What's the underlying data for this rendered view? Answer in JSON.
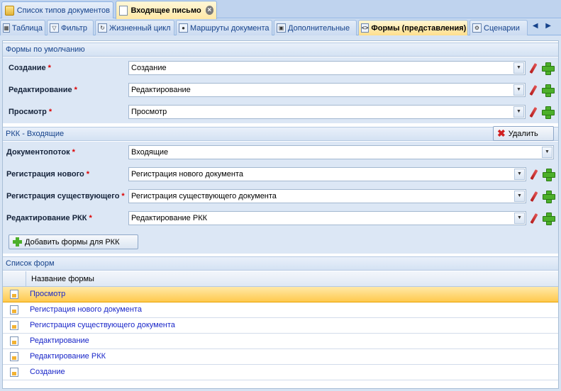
{
  "doc_tabs": [
    {
      "label": "Список типов документов",
      "icon": "folder-icon",
      "active": false
    },
    {
      "label": "Входящее письмо",
      "icon": "document-icon",
      "active": true
    }
  ],
  "prop_tabs": [
    {
      "label": "Таблица",
      "icon": "table-icon"
    },
    {
      "label": "Фильтр",
      "icon": "filter-icon"
    },
    {
      "label": "Жизненный цикл",
      "icon": "lifecycle-icon"
    },
    {
      "label": "Маршруты документа",
      "icon": "routes-icon"
    },
    {
      "label": "Дополнительные",
      "icon": "extra-icon"
    },
    {
      "label": "Формы (представления)",
      "icon": "forms-icon",
      "active": true
    },
    {
      "label": "Сценарии",
      "icon": "scenarios-icon"
    }
  ],
  "nav_arrows": "◀ ▶",
  "default_forms": {
    "header": "Формы по умолчанию",
    "rows": [
      {
        "label": "Создание",
        "value": "Создание"
      },
      {
        "label": "Редактирование",
        "value": "Редактирование"
      },
      {
        "label": "Просмотр",
        "value": "Просмотр"
      }
    ]
  },
  "rkk": {
    "header": "РКК - Входящие",
    "delete_label": "Удалить",
    "docflow": {
      "label": "Документопоток",
      "value": "Входящие"
    },
    "rows": [
      {
        "label": "Регистрация нового",
        "value": "Регистрация нового документа"
      },
      {
        "label": "Регистрация существующего",
        "value": "Регистрация существующего документа"
      },
      {
        "label": "Редактирование РКК",
        "value": "Редактирование РКК"
      }
    ],
    "add_label": "Добавить формы для РКК"
  },
  "forms_list": {
    "header": "Список форм",
    "column": "Название формы",
    "rows": [
      "Просмотр",
      "Регистрация нового документа",
      "Регистрация существующего документа",
      "Редактирование",
      "Редактирование РКК",
      "Создание"
    ],
    "selected_index": 0
  },
  "required_mark": "*",
  "colors": {
    "accent": "#15428b",
    "selected_row": "#ffc94d",
    "required": "#dd0000"
  }
}
